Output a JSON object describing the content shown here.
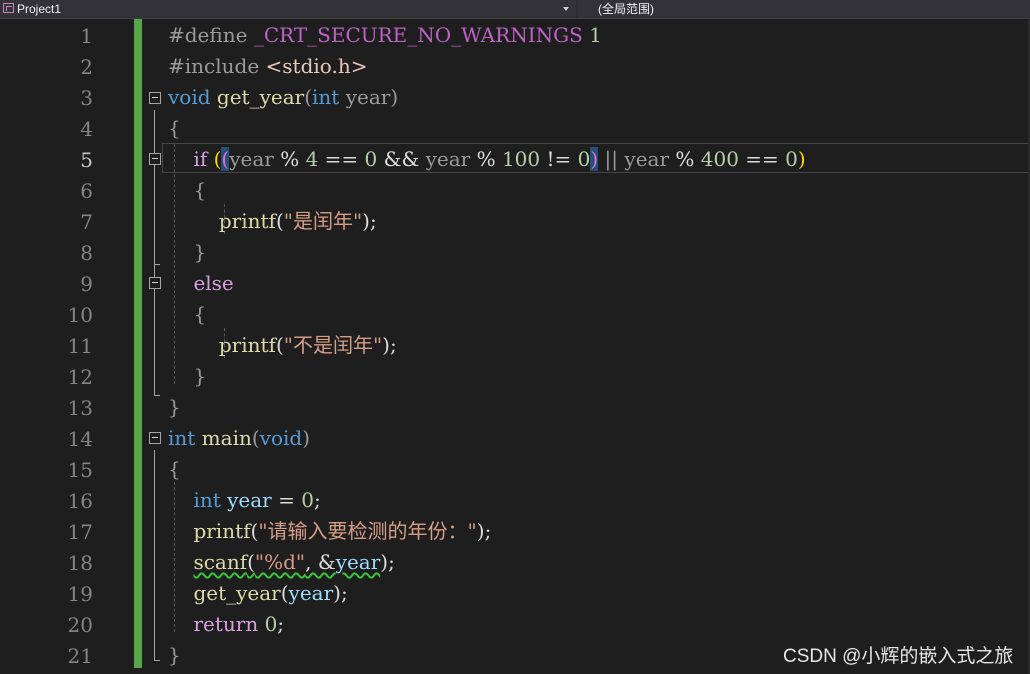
{
  "nav": {
    "project": "Project1",
    "scope": "(全局范围)"
  },
  "line_numbers": [
    "1",
    "2",
    "3",
    "4",
    "5",
    "6",
    "7",
    "8",
    "9",
    "10",
    "11",
    "12",
    "13",
    "14",
    "15",
    "16",
    "17",
    "18",
    "19",
    "20",
    "21"
  ],
  "active_line": "5",
  "code": {
    "l1": {
      "directive": "#define ",
      "macro": "_CRT_SECURE_NO_WARNINGS",
      "value": " 1"
    },
    "l2": {
      "directive": "#include ",
      "header": "<stdio.h>"
    },
    "l3": {
      "type": "void",
      "name": " get_year",
      "open": "(",
      "ptype": "int",
      "param": " year",
      "close": ")"
    },
    "l4": {
      "brace": "{"
    },
    "l5": {
      "kw": "if",
      "sp": " ",
      "open1": "(",
      "open2": "(",
      "a": "year",
      "b": " % ",
      "c": "4",
      "d": " == ",
      "e": "0",
      "f": " && ",
      "g": "year",
      "h": " % ",
      "i": "100",
      "j": " != ",
      "k": "0",
      "close2": ")",
      "or": " || ",
      "m": "year",
      "n": " % ",
      "o": "400",
      "p": " == ",
      "q": "0",
      "close1": ")"
    },
    "l6": {
      "brace": "{"
    },
    "l7": {
      "fn": "printf",
      "open": "(",
      "str": "\"是闰年\"",
      "close": ")",
      "semi": ";"
    },
    "l8": {
      "brace": "}"
    },
    "l9": {
      "kw": "else"
    },
    "l10": {
      "brace": "{"
    },
    "l11": {
      "fn": "printf",
      "open": "(",
      "str": "\"不是闰年\"",
      "close": ")",
      "semi": ";"
    },
    "l12": {
      "brace": "}"
    },
    "l13": {
      "brace": "}"
    },
    "l14": {
      "type": "int",
      "name": " main",
      "open": "(",
      "ptype": "void",
      "close": ")"
    },
    "l15": {
      "brace": "{"
    },
    "l16": {
      "type": "int",
      "var": " year",
      "rest": " = ",
      "num": "0",
      "semi": ";"
    },
    "l17": {
      "fn": "printf",
      "open": "(",
      "str": "\"请输入要检测的年份：\"",
      "close": ")",
      "semi": ";"
    },
    "l18": {
      "fn": "scanf",
      "open": "(",
      "str": "\"%d\"",
      "comma": ", &",
      "var": "year",
      "close": ")",
      "semi": ";"
    },
    "l19": {
      "fn": "get_year",
      "open": "(",
      "var": "year",
      "close": ")",
      "semi": ";"
    },
    "l20": {
      "kw": "return",
      "rest": " ",
      "num": "0",
      "semi": ";"
    },
    "l21": {
      "brace": "}"
    }
  },
  "watermark": "CSDN @小辉的嵌入式之旅"
}
